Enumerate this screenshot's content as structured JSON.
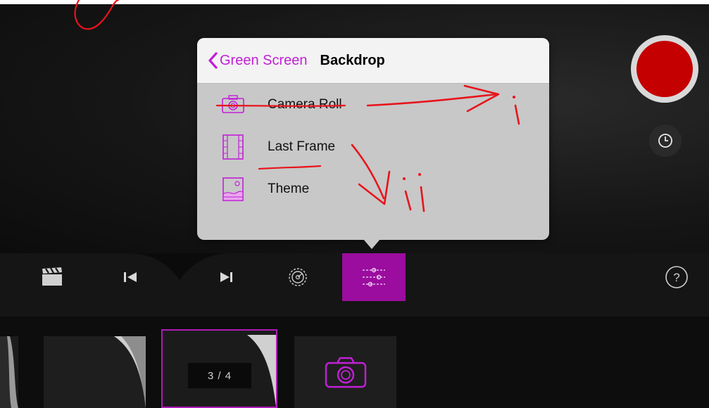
{
  "popover": {
    "back_label": "Green Screen",
    "title": "Backdrop",
    "items": [
      {
        "label": "Camera Roll",
        "icon": "camera-icon"
      },
      {
        "label": "Last Frame",
        "icon": "film-frame-icon"
      },
      {
        "label": "Theme",
        "icon": "theme-image-icon"
      }
    ]
  },
  "toolbar": {
    "items": [
      "clapperboard-icon",
      "skip-back-icon",
      "skip-forward-icon",
      "settings-gear-icon",
      "sliders-icon",
      "help-icon"
    ],
    "help_label": "?"
  },
  "filmstrip": {
    "frame_badge": "3 / 4"
  },
  "annotations": {
    "label_i": "i",
    "label_ii": "ii"
  },
  "colors": {
    "accent": "#c21fd8",
    "active_tool": "#9a0d9e",
    "record": "#c40000",
    "annotation": "#e8141c"
  }
}
